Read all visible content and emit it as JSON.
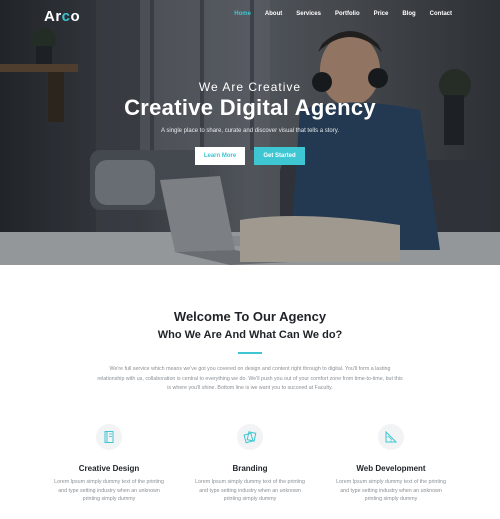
{
  "brand": {
    "logo_prefix": "Ar",
    "logo_accent": "c",
    "logo_suffix": "o"
  },
  "nav": {
    "items": [
      "Home",
      "About",
      "Services",
      "Portfolio",
      "Price",
      "Blog",
      "Contact"
    ],
    "active": "Home"
  },
  "hero": {
    "kicker": "We Are Creative",
    "title": "Creative Digital Agency",
    "subtitle": "A single place to share, curate and discover visual that tells a story.",
    "learn_more_label": "Learn More",
    "get_started_label": "Get Started"
  },
  "welcome": {
    "title": "Welcome To Our Agency",
    "subtitle": "Who We Are And What Can We do?",
    "body": "We're full service which means we've got you covered on design and content right through to digital. You'll form a lasting relationship with us, collaboration is central to everything we do. We'll push you out of your comfort zone from time-to-time, but this is where you'll shine. Bottom line is we want you to succeed at Faculty."
  },
  "services": [
    {
      "icon": "notebook-icon",
      "title": "Creative Design",
      "text": "Lorem Ipsum simply dummy text of the printing and type setting industry when an unknown printing simply dummy"
    },
    {
      "icon": "cards-icon",
      "title": "Branding",
      "text": "Lorem Ipsum simply dummy text of the printing and type setting industry when an unknown printing simply dummy"
    },
    {
      "icon": "ruler-icon",
      "title": "Web Development",
      "text": "Lorem Ipsum simply dummy text of the printing and type setting industry when an unknown printing simply dummy"
    }
  ],
  "colors": {
    "accent": "#3ec6d3",
    "heading": "#1f2328",
    "body_text": "#8a8f94"
  }
}
